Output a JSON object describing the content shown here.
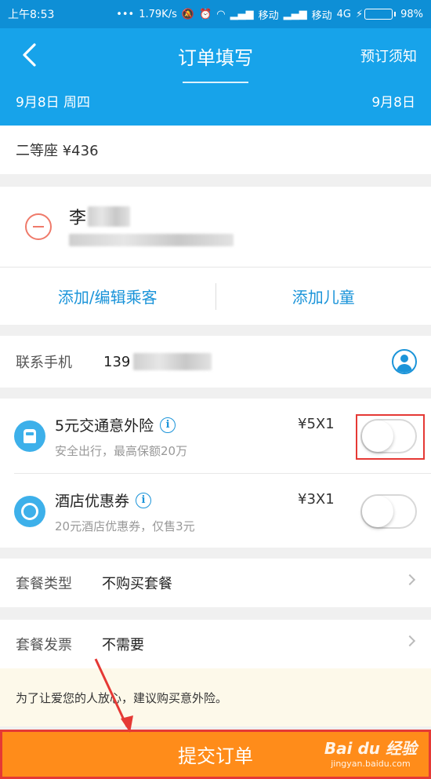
{
  "status_bar": {
    "time": "上午8:53",
    "speed": "1.79K/s",
    "carrier1": "移动",
    "carrier2": "移动",
    "network": "4G",
    "battery": "98%",
    "battery_level": 0.98,
    "battery_color": "#6bd04b"
  },
  "header": {
    "title": "订单填写",
    "back_icon": "chevron-left-icon",
    "notice_label": "预订须知",
    "date_left": "9月8日 周四",
    "date_right": "9月8日",
    "color": "#17a3ea"
  },
  "seat": {
    "label": "二等座 ¥436"
  },
  "passenger": {
    "name": "李",
    "add_edit_label": "添加/编辑乘客",
    "add_child_label": "添加儿童"
  },
  "contact": {
    "label": "联系手机",
    "value": "139"
  },
  "addons": [
    {
      "title": "5元交通意外险",
      "subtitle": "安全出行，最高保额20万",
      "price": "¥5X1",
      "icon": "car-icon",
      "enabled": false
    },
    {
      "title": "酒店优惠券",
      "subtitle": "20元酒店优惠券，仅售3元",
      "price": "¥3X1",
      "icon": "hotel-coupon-icon",
      "enabled": false
    }
  ],
  "package_type": {
    "label": "套餐类型",
    "value": "不购买套餐"
  },
  "package_invoice": {
    "label": "套餐发票",
    "value": "不需要"
  },
  "tip": "为了让爱您的人放心，建议购买意外险。",
  "submit_label": "提交订单",
  "submit_color": "#ff8c1a",
  "watermark": {
    "main": "Bai du 经验",
    "sub": "jingyan.baidu.com"
  }
}
